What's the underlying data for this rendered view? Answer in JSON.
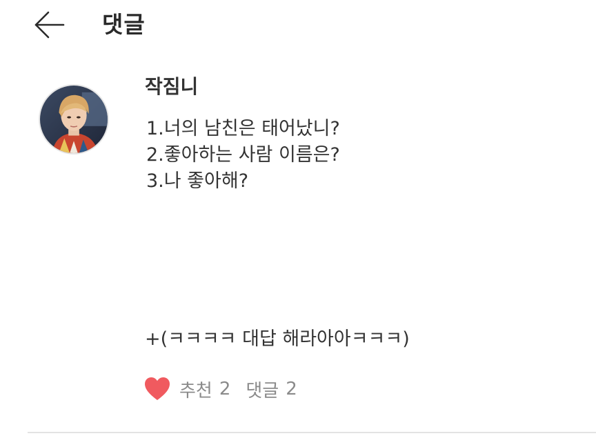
{
  "header": {
    "title": "댓글",
    "back_icon": "arrow-left-icon"
  },
  "comment": {
    "author": "작짐니",
    "avatar_icon": "user-avatar-photo",
    "lines": [
      "1.너의 남친은 태어났니?",
      "2.좋아하는 사람 이름은?",
      "3.나 좋아해?"
    ],
    "extra": "+(ㅋㅋㅋㅋ 대답 해라아아ㅋㅋㅋ)",
    "like_icon": "heart-icon",
    "like_color": "#f05a5f",
    "like_label": "추천",
    "like_count": "2",
    "reply_label": "댓글",
    "reply_count": "2"
  }
}
